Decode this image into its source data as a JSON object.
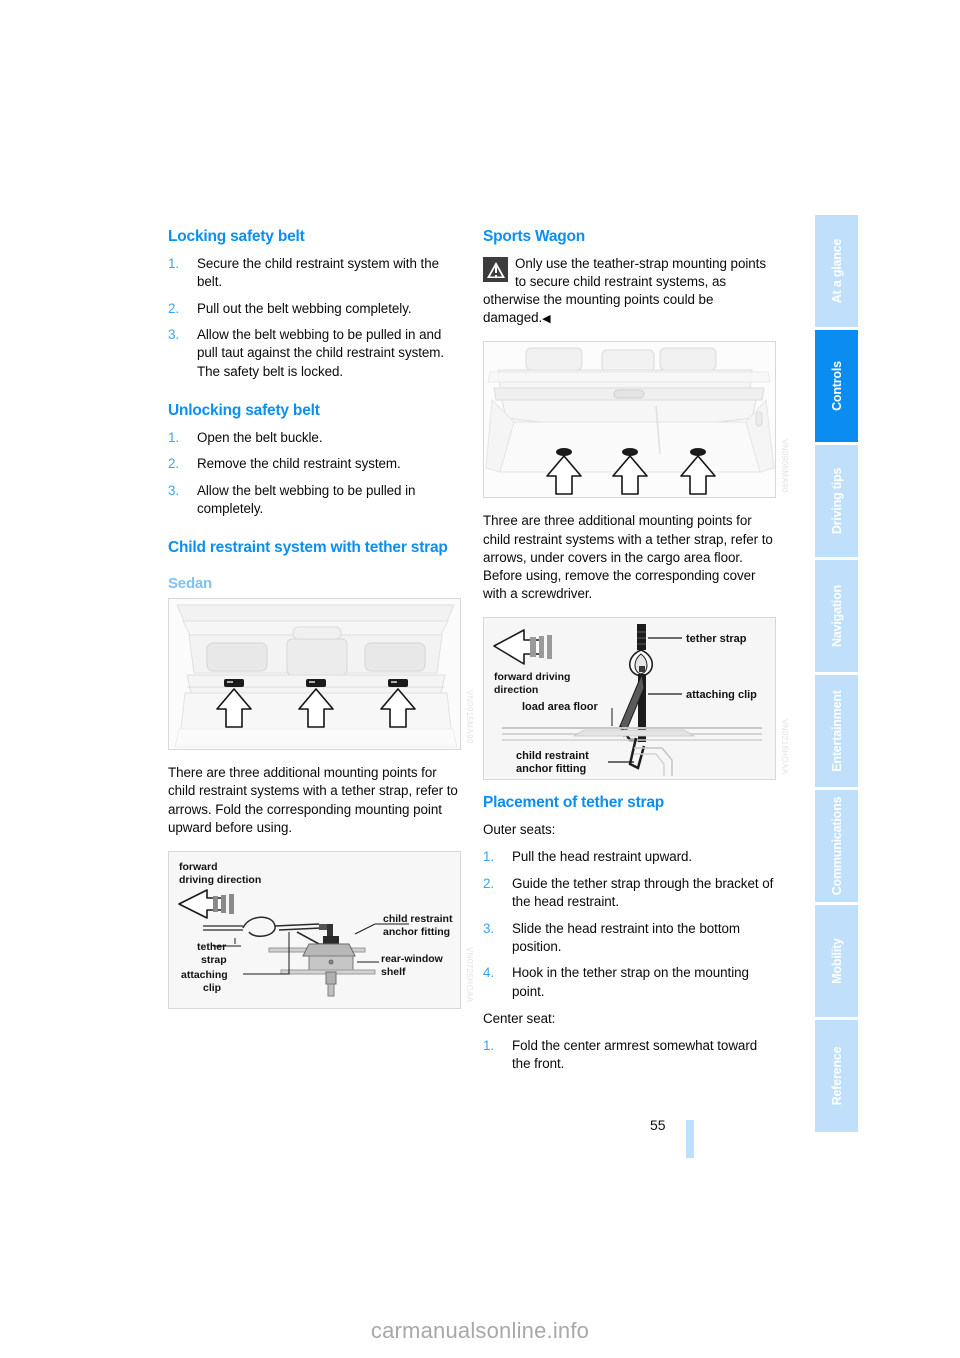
{
  "document": {
    "page_number": "55",
    "site_watermark": "carmanualsonline.info"
  },
  "sidebar": {
    "tabs": [
      {
        "label": "At a glance",
        "active": false
      },
      {
        "label": "Controls",
        "active": true
      },
      {
        "label": "Driving tips",
        "active": false
      },
      {
        "label": "Navigation",
        "active": false
      },
      {
        "label": "Entertainment",
        "active": false
      },
      {
        "label": "Communications",
        "active": false
      },
      {
        "label": "Mobility",
        "active": false
      },
      {
        "label": "Reference",
        "active": false
      }
    ]
  },
  "left_column": {
    "locking": {
      "heading": "Locking safety belt",
      "steps": [
        {
          "num": "1.",
          "text": "Secure the child restraint system with the belt."
        },
        {
          "num": "2.",
          "text": "Pull out the belt webbing completely."
        },
        {
          "num": "3.",
          "text": "Allow the belt webbing to be pulled in and pull taut against the child restraint system. The safety belt is locked."
        }
      ]
    },
    "unlocking": {
      "heading": "Unlocking safety belt",
      "steps": [
        {
          "num": "1.",
          "text": "Open the belt buckle."
        },
        {
          "num": "2.",
          "text": "Remove the child restraint system."
        },
        {
          "num": "3.",
          "text": "Allow the belt webbing to be pulled in completely."
        }
      ]
    },
    "tether": {
      "heading": "Child restraint system with tether strap",
      "subheading": "Sedan",
      "figure_sedan_watermark": "VN0915MA90",
      "caption": "There are three additional mounting points for child restraint systems with a tether strap, refer to arrows. Fold the corresponding mounting point upward before using.",
      "figure_detail_watermark": "VN0725HOAA",
      "figure_detail_labels": {
        "forward_driving_direction": "forward\ndriving direction",
        "tether_strap": "tether\nstrap",
        "attaching_clip": "attaching\nclip",
        "child_restraint_anchor_fitting": "child restraint\nanchor fitting",
        "rear_window_shelf": "rear-window\nshelf"
      }
    }
  },
  "right_column": {
    "sports_wagon": {
      "heading": "Sports Wagon",
      "warning_icon": "warning-triangle-icon",
      "warning_text": "Only use the teather-strap mounting points to secure child restraint systems, as otherwise the mounting points could be damaged.",
      "warning_endmark": "◀",
      "figure_wagon_watermark": "VN0906MA90",
      "caption": "Three are three additional mounting points for child restraint systems with a tether strap, refer to arrows, under covers in the cargo area floor. Before using, remove the corresponding cover with a screwdriver.",
      "figure_detail_watermark": "VN0216HOAA",
      "figure_detail_labels": {
        "tether_strap": "tether strap",
        "attaching_clip": "attaching clip",
        "forward_driving_direction": "forward driving\ndirection",
        "load_area_floor": "load area floor",
        "child_restraint_anchor_fitting": "child restraint\nanchor fitting"
      }
    },
    "placement": {
      "heading": "Placement of tether strap",
      "outer_seats_label": "Outer seats:",
      "outer_steps": [
        {
          "num": "1.",
          "text": "Pull the head restraint upward."
        },
        {
          "num": "2.",
          "text": "Guide the tether strap through the bracket of the head restraint."
        },
        {
          "num": "3.",
          "text": "Slide the head restraint into the bottom position."
        },
        {
          "num": "4.",
          "text": "Hook in the tether strap on the mounting point."
        }
      ],
      "center_seat_label": "Center seat:",
      "center_steps": [
        {
          "num": "1.",
          "text": "Fold the center armrest somewhat toward the front."
        }
      ]
    }
  },
  "colors": {
    "heading_blue": "#0b8ff0",
    "subheading_blue": "#7ec2f2",
    "number_blue": "#3aa4f2",
    "tab_active": "#0a8cf0",
    "tab_inactive": "#bfdffa"
  }
}
